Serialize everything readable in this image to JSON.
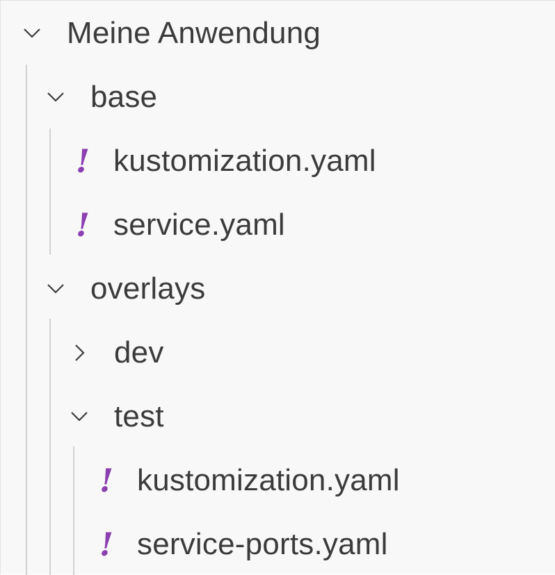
{
  "explorer": {
    "root": {
      "label": "Meine Anwendung",
      "expanded": true
    },
    "base": {
      "label": "base",
      "expanded": true,
      "files": [
        {
          "label": "kustomization.yaml",
          "icon": "yaml-icon"
        },
        {
          "label": "service.yaml",
          "icon": "yaml-icon"
        }
      ]
    },
    "overlays": {
      "label": "overlays",
      "expanded": true,
      "dev": {
        "label": "dev",
        "expanded": false
      },
      "test": {
        "label": "test",
        "expanded": true,
        "files": [
          {
            "label": "kustomization.yaml",
            "icon": "yaml-icon"
          },
          {
            "label": "service-ports.yaml",
            "icon": "yaml-icon"
          }
        ]
      }
    },
    "icon_glyph": "!",
    "colors": {
      "text": "#3b3b3b",
      "yaml_icon": "#8b3fb0",
      "indent_guide": "#d2d2d2",
      "background": "#f8f8f8"
    }
  }
}
